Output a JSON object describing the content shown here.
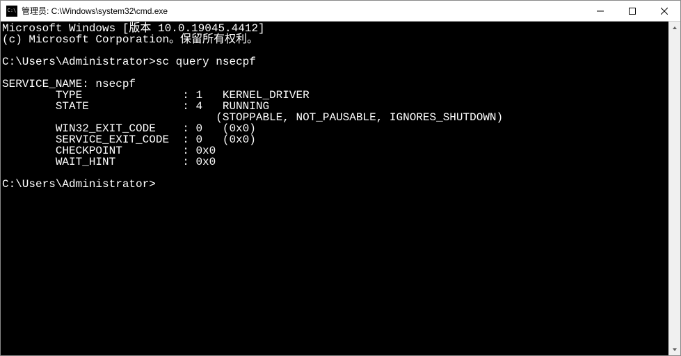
{
  "window": {
    "title": "管理员: C:\\Windows\\system32\\cmd.exe"
  },
  "terminal": {
    "line1": "Microsoft Windows [版本 10.0.19045.4412]",
    "line2": "(c) Microsoft Corporation。保留所有权利。",
    "blank1": "",
    "prompt1_path": "C:\\Users\\Administrator>",
    "prompt1_cmd": "sc query nsecpf",
    "blank2": "",
    "svc_name": "SERVICE_NAME: nsecpf",
    "type": "        TYPE               : 1   KERNEL_DRIVER",
    "state": "        STATE              : 4   RUNNING",
    "state_flags": "                                (STOPPABLE, NOT_PAUSABLE, IGNORES_SHUTDOWN)",
    "win32_exit": "        WIN32_EXIT_CODE    : 0   (0x0)",
    "service_exit": "        SERVICE_EXIT_CODE  : 0   (0x0)",
    "checkpoint": "        CHECKPOINT         : 0x0",
    "wait_hint": "        WAIT_HINT          : 0x0",
    "blank3": "",
    "prompt2_path": "C:\\Users\\Administrator>",
    "prompt2_cmd": ""
  }
}
